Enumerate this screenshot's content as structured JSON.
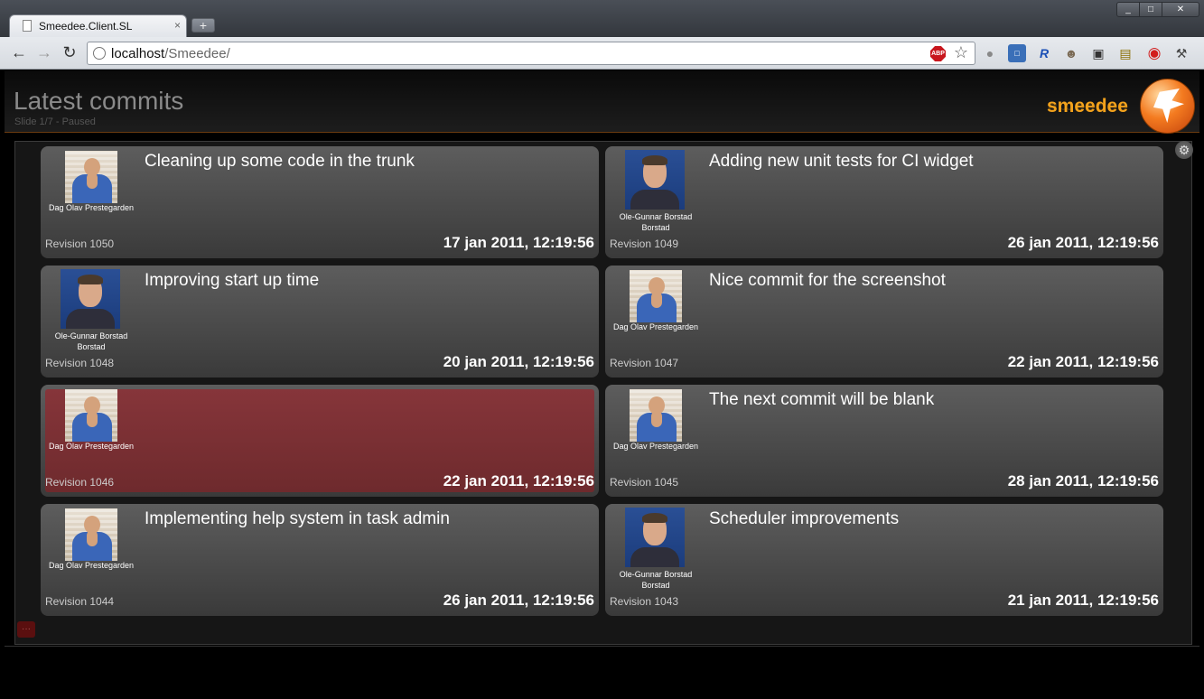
{
  "browser": {
    "tab_title": "Smeedee.Client.SL",
    "tab_close": "×",
    "new_tab": "+",
    "url_host": "localhost",
    "url_path": "/Smeedee/",
    "win_min": "_",
    "win_max": "□",
    "win_close": "✕"
  },
  "header": {
    "title": "Latest commits",
    "slide_status": "Slide 1/7 - Paused",
    "logo": "smeedee"
  },
  "commits": [
    {
      "message": "Cleaning up some code in the trunk",
      "author_line1": "Dag Olav  Prestegarden",
      "author_line2": "",
      "avatar": "dag",
      "revision": "Revision 1050",
      "date": "17 jan 2011, 12:19:56",
      "blank": false
    },
    {
      "message": "Adding new unit tests for CI widget",
      "author_line1": "Ole-Gunnar  Borstad",
      "author_line2": "Borstad",
      "avatar": "ole",
      "revision": "Revision 1049",
      "date": "26 jan 2011, 12:19:56",
      "blank": false
    },
    {
      "message": "Improving start up time",
      "author_line1": "Ole-Gunnar  Borstad",
      "author_line2": "Borstad",
      "avatar": "ole",
      "revision": "Revision 1048",
      "date": "20 jan 2011, 12:19:56",
      "blank": false
    },
    {
      "message": "Nice commit for the screenshot",
      "author_line1": "Dag Olav  Prestegarden",
      "author_line2": "",
      "avatar": "dag",
      "revision": "Revision 1047",
      "date": "22 jan 2011, 12:19:56",
      "blank": false
    },
    {
      "message": "",
      "author_line1": "Dag Olav  Prestegarden",
      "author_line2": "",
      "avatar": "dag",
      "revision": "Revision 1046",
      "date": "22 jan 2011, 12:19:56",
      "blank": true
    },
    {
      "message": "The next commit will be blank",
      "author_line1": "Dag Olav  Prestegarden",
      "author_line2": "",
      "avatar": "dag",
      "revision": "Revision 1045",
      "date": "28 jan 2011, 12:19:56",
      "blank": false
    },
    {
      "message": "Implementing help system in task admin",
      "author_line1": "Dag Olav  Prestegarden",
      "author_line2": "",
      "avatar": "dag",
      "revision": "Revision 1044",
      "date": "26 jan 2011, 12:19:56",
      "blank": false
    },
    {
      "message": "Scheduler improvements",
      "author_line1": "Ole-Gunnar  Borstad",
      "author_line2": "Borstad",
      "avatar": "ole",
      "revision": "Revision 1043",
      "date": "21 jan 2011, 12:19:56",
      "blank": false
    }
  ],
  "colors": {
    "accent": "#f3a21c",
    "blank_commit": "#7a2f33"
  }
}
